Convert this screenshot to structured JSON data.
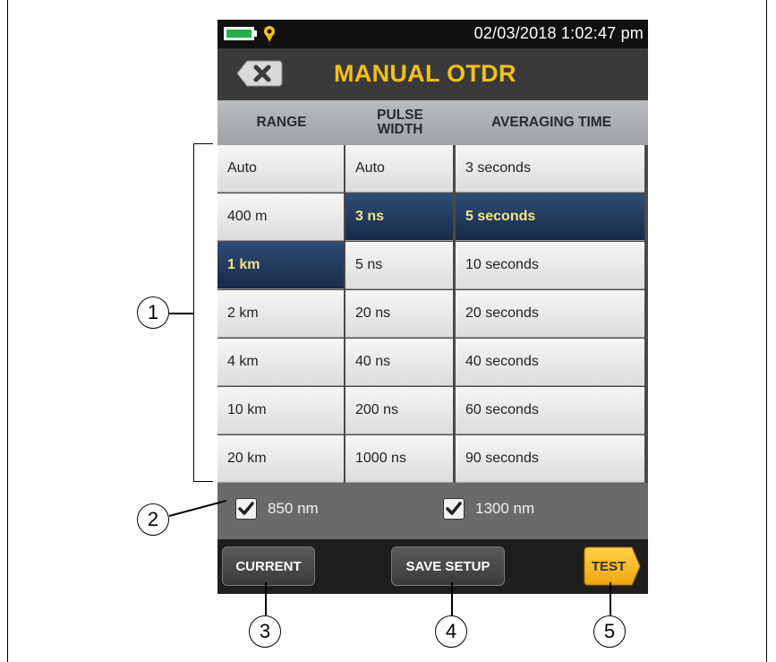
{
  "status": {
    "datetime": "02/03/2018 1:02:47 pm"
  },
  "header": {
    "title": "MANUAL OTDR"
  },
  "columns": {
    "range": {
      "header": "RANGE",
      "items": [
        "Auto",
        "400 m",
        "1 km",
        "2 km",
        "4 km",
        "10 km",
        "20 km"
      ],
      "selected": "1 km"
    },
    "pulse_width": {
      "header": "PULSE\nWIDTH",
      "items": [
        "Auto",
        "3 ns",
        "5 ns",
        "20 ns",
        "40 ns",
        "200 ns",
        "1000 ns"
      ],
      "selected": "3 ns"
    },
    "averaging_time": {
      "header": "AVERAGING TIME",
      "items": [
        "3 seconds",
        "5 seconds",
        "10 seconds",
        "20 seconds",
        "40 seconds",
        "60 seconds",
        "90 seconds"
      ],
      "selected": "5 seconds"
    }
  },
  "wavelengths": [
    {
      "label": "850 nm",
      "checked": true
    },
    {
      "label": "1300 nm",
      "checked": true
    }
  ],
  "buttons": {
    "current": "CURRENT",
    "save_setup": "SAVE SETUP",
    "test": "TEST"
  },
  "callouts": [
    "1",
    "2",
    "3",
    "4",
    "5"
  ],
  "colors": {
    "title": "#f4c01a",
    "selected_bg": "#1f3a60",
    "selected_text": "#f7e38a",
    "test_button": "#f5b021",
    "battery": "#22b04a"
  },
  "icons": {
    "battery": "battery-icon",
    "location": "pin-icon",
    "back": "back-x-icon",
    "checkbox": "check-icon"
  }
}
